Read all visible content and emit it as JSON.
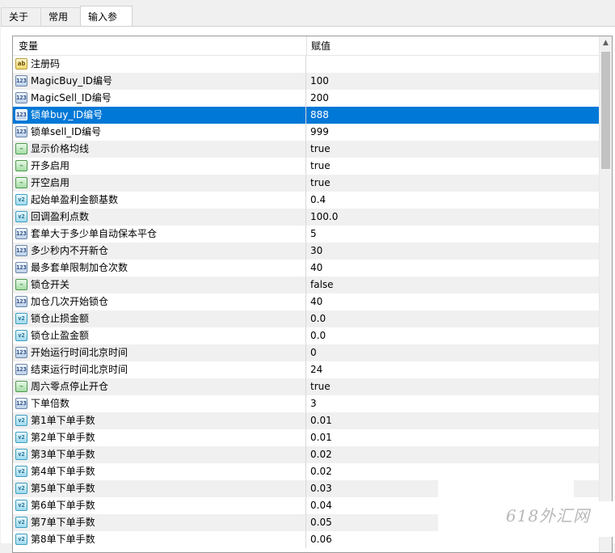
{
  "tabs": [
    "关于",
    "常用",
    "输入参数"
  ],
  "active_tab": "输入参数",
  "table": {
    "col_variable": "变量",
    "col_value": "赋值",
    "rows": [
      {
        "type": "str",
        "name": "注册码",
        "value": ""
      },
      {
        "type": "int",
        "name": "MagicBuy_ID编号",
        "value": "100"
      },
      {
        "type": "int",
        "name": "MagicSell_ID编号",
        "value": "200"
      },
      {
        "type": "int",
        "name": "锁单buy_ID编号",
        "value": "888"
      },
      {
        "type": "int",
        "name": "锁单sell_ID编号",
        "value": "999"
      },
      {
        "type": "bool",
        "name": "显示价格均线",
        "value": "true"
      },
      {
        "type": "bool",
        "name": "开多启用",
        "value": "true"
      },
      {
        "type": "bool",
        "name": "开空启用",
        "value": "true"
      },
      {
        "type": "dbl",
        "name": "起始单盈利金额基数",
        "value": "0.4"
      },
      {
        "type": "dbl",
        "name": "回调盈利点数",
        "value": "100.0"
      },
      {
        "type": "int",
        "name": "套单大于多少单自动保本平仓",
        "value": "5"
      },
      {
        "type": "int",
        "name": "多少秒内不开新仓",
        "value": "30"
      },
      {
        "type": "int",
        "name": "最多套单限制加仓次数",
        "value": "40"
      },
      {
        "type": "bool",
        "name": "锁仓开关",
        "value": "false"
      },
      {
        "type": "int",
        "name": "加仓几次开始锁仓",
        "value": "40"
      },
      {
        "type": "dbl",
        "name": "锁仓止损金额",
        "value": "0.0"
      },
      {
        "type": "dbl",
        "name": "锁仓止盈金额",
        "value": "0.0"
      },
      {
        "type": "int",
        "name": "开始运行时间北京时间",
        "value": "0"
      },
      {
        "type": "int",
        "name": "结束运行时间北京时间",
        "value": "24"
      },
      {
        "type": "bool",
        "name": "周六零点停止开仓",
        "value": "true"
      },
      {
        "type": "int",
        "name": "下单倍数",
        "value": "3"
      },
      {
        "type": "dbl",
        "name": "第1单下单手数",
        "value": "0.01"
      },
      {
        "type": "dbl",
        "name": "第2单下单手数",
        "value": "0.01"
      },
      {
        "type": "dbl",
        "name": "第3单下单手数",
        "value": "0.02"
      },
      {
        "type": "dbl",
        "name": "第4单下单手数",
        "value": "0.02"
      },
      {
        "type": "dbl",
        "name": "第5单下单手数",
        "value": "0.03"
      },
      {
        "type": "dbl",
        "name": "第6单下单手数",
        "value": "0.04"
      },
      {
        "type": "dbl",
        "name": "第7单下单手数",
        "value": "0.05"
      },
      {
        "type": "dbl",
        "name": "第8单下单手数",
        "value": "0.06"
      }
    ],
    "selected_index": 3
  },
  "icon_text": {
    "str": "ab",
    "int": "123",
    "bool": "~",
    "dbl": "v2"
  },
  "watermark": "618外汇网",
  "colors": {
    "selection": "#0078d7",
    "alt_row": "#f0f0f0"
  }
}
